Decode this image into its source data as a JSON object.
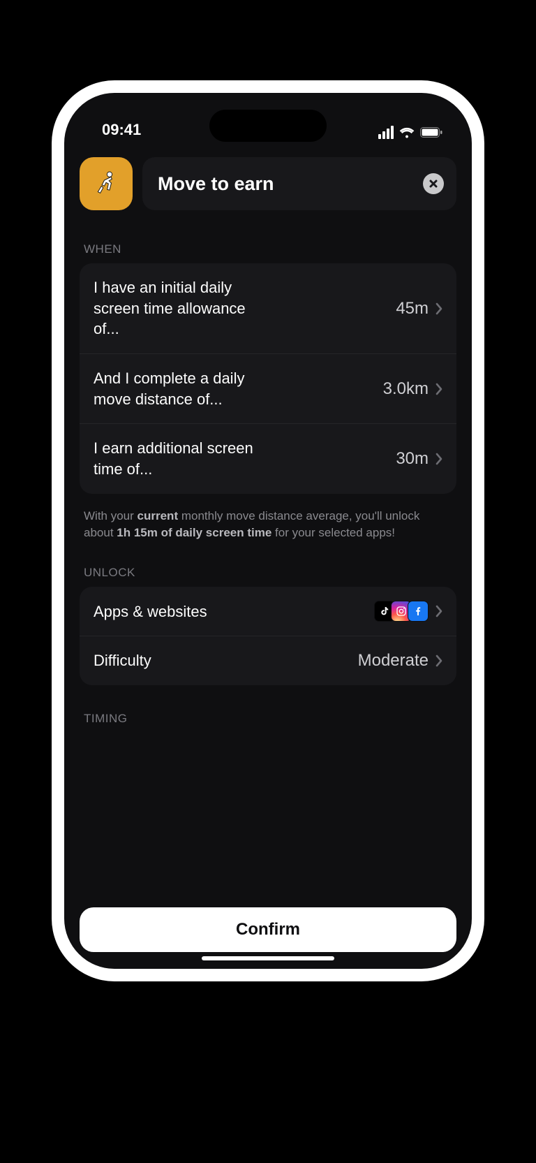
{
  "status": {
    "time": "09:41"
  },
  "header": {
    "icon": "running-person-icon",
    "title": "Move to earn",
    "close": "close"
  },
  "sections": {
    "when": {
      "label": "WHEN",
      "rows": [
        {
          "label": "I have an initial daily screen time allowance of...",
          "value": "45m"
        },
        {
          "label": "And I complete a daily move distance of...",
          "value": "3.0km"
        },
        {
          "label": "I earn additional screen time of...",
          "value": "30m"
        }
      ],
      "helper": {
        "pre": "With your ",
        "b1": "current",
        "mid": " monthly move distance average, you'll unlock about ",
        "b2": "1h 15m of daily screen time",
        "post": " for your selected apps!"
      }
    },
    "unlock": {
      "label": "UNLOCK",
      "rows": [
        {
          "label": "Apps & websites",
          "value": ""
        },
        {
          "label": "Difficulty",
          "value": "Moderate"
        }
      ],
      "app_icons": [
        "tiktok",
        "instagram",
        "facebook"
      ]
    },
    "timing": {
      "label": "TIMING"
    }
  },
  "footer": {
    "confirm": "Confirm"
  }
}
